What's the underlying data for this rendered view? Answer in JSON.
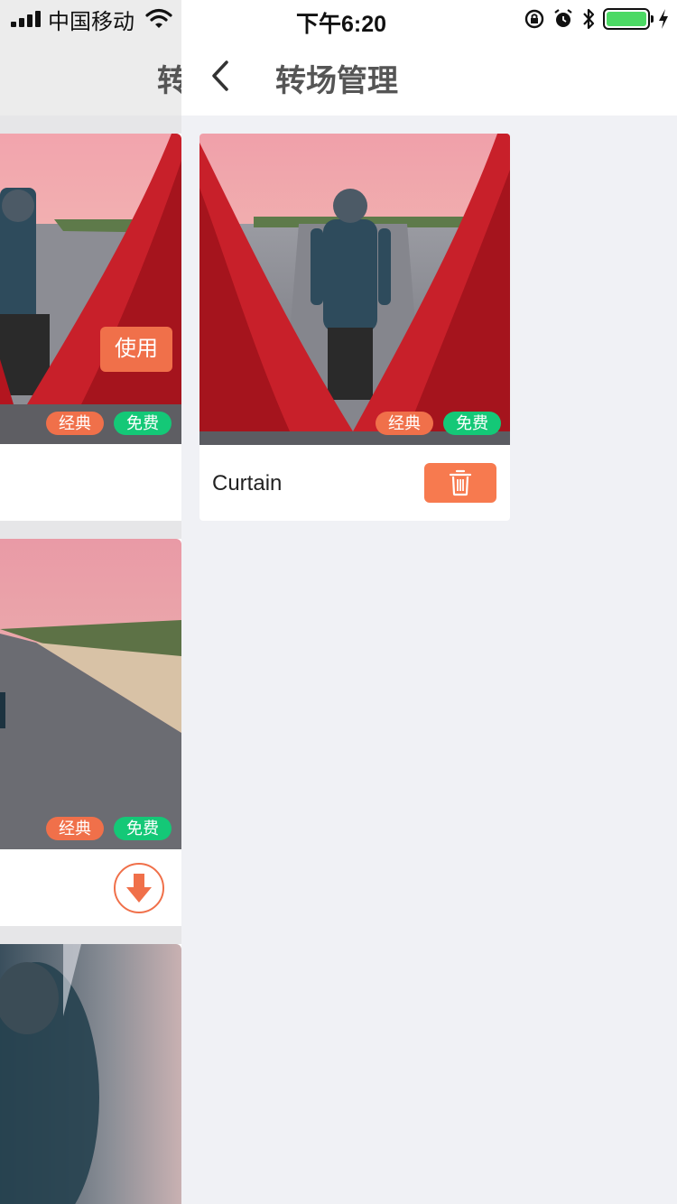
{
  "status_bar": {
    "carrier": "中国移动",
    "time": "下午6:20",
    "battery_level": 1.0
  },
  "background_page": {
    "title": "转场管理",
    "cards": [
      {
        "badges": [
          "经典",
          "免费"
        ],
        "action": "使用"
      },
      {
        "badges": [
          "经典",
          "免费"
        ],
        "action": "download-icon"
      },
      {
        "badges": [],
        "action": ""
      }
    ]
  },
  "main_page": {
    "title": "转场管理",
    "items": [
      {
        "name": "Curtain",
        "badges": [
          "经典",
          "免费"
        ],
        "action": "trash-icon"
      }
    ]
  },
  "colors": {
    "accent": "#f0704a",
    "free_badge": "#14c877",
    "page_bg": "#f0f1f5"
  }
}
